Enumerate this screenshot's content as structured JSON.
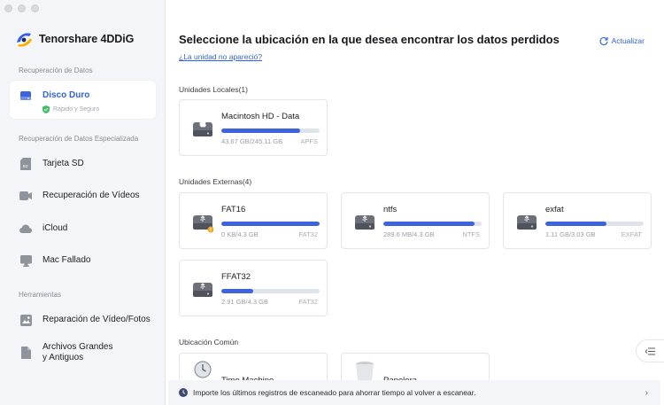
{
  "app": {
    "name": "Tenorshare 4DDiG"
  },
  "sidebar": {
    "section_recovery": "Recuperación de Datos",
    "disk": {
      "label": "Disco Duro",
      "note": "Rápido y Seguro"
    },
    "section_special": "Recuperación de Datos Especializada",
    "special_items": [
      {
        "label": "Tarjeta SD",
        "icon": "sd-card-icon"
      },
      {
        "label": "Recuperación de Vídeos",
        "icon": "video-camera-icon"
      },
      {
        "label": "iCloud",
        "icon": "cloud-icon"
      },
      {
        "label": "Mac Fallado",
        "icon": "crashed-mac-icon"
      }
    ],
    "section_tools": "Herramientas",
    "tool_items": [
      {
        "label": "Reparación de Vídeo/Fotos",
        "icon": "photo-repair-icon"
      },
      {
        "label": "Archivos Grandes",
        "label2": "y Antiguos",
        "icon": "file-icon"
      }
    ]
  },
  "main": {
    "title": "Seleccione la ubicación en la que desea encontrar los datos perdidos",
    "link": "¿La unidad no apareció?",
    "refresh": "Actualizar",
    "local_label": "Unidades Locales(1)",
    "local": [
      {
        "name": "Macintosh HD - Data",
        "size": "43.67 GB/245.11 GB",
        "fs": "APFS",
        "used": 0.8
      }
    ],
    "external_label": "Unidades Externas(4)",
    "external": [
      {
        "name": "FAT16",
        "size": "0 KB/4.3 GB",
        "fs": "FAT32",
        "used": 1.0
      },
      {
        "name": "ntfs",
        "size": "289.6 MB/4.3 GB",
        "fs": "NTFS",
        "used": 0.93
      },
      {
        "name": "exfat",
        "size": "1.11 GB/3.03 GB",
        "fs": "EXFAT",
        "used": 0.62
      },
      {
        "name": "FFAT32",
        "size": "2.91 GB/4.3 GB",
        "fs": "FAT32",
        "used": 0.32
      }
    ],
    "common_label": "Ubicación Común",
    "common": [
      {
        "name": "Time Machine"
      },
      {
        "name": "Papelera"
      }
    ],
    "bottom_text": "Importe los últimos registros de escaneado para ahorrar tiempo al volver a escanear."
  },
  "colors": {
    "accent": "#2f62e6",
    "bar_fill": "#3d63dd",
    "sidebar_bg": "#f4f5f8"
  }
}
